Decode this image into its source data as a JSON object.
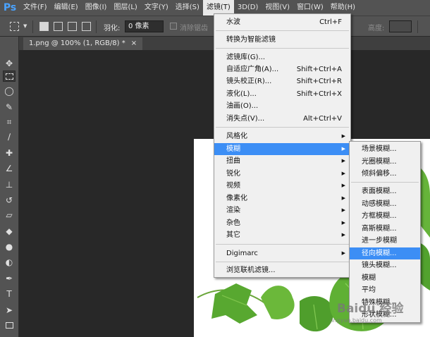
{
  "app": {
    "logo": "Ps"
  },
  "menubar": {
    "items": [
      "文件(F)",
      "编辑(E)",
      "图像(I)",
      "图层(L)",
      "文字(Y)",
      "选择(S)",
      "滤镜(T)",
      "3D(D)",
      "视图(V)",
      "窗口(W)",
      "帮助(H)"
    ],
    "active_index": 6
  },
  "options": {
    "feather_label": "羽化:",
    "feather_value": "0 像素",
    "antialias_label": "消除锯齿",
    "height_label": "高度:"
  },
  "document_tab": {
    "title": "1.png @ 100% (1, RGB/8) *",
    "close": "×"
  },
  "filter_menu": {
    "items": [
      {
        "label": "水波",
        "shortcut": "Ctrl+F"
      },
      {
        "label": "转换为智能滤镜"
      },
      {
        "label": "滤镜库(G)..."
      },
      {
        "label": "自适应广角(A)...",
        "shortcut": "Shift+Ctrl+A"
      },
      {
        "label": "镜头校正(R)...",
        "shortcut": "Shift+Ctrl+R"
      },
      {
        "label": "液化(L)...",
        "shortcut": "Shift+Ctrl+X"
      },
      {
        "label": "油画(O)..."
      },
      {
        "label": "消失点(V)...",
        "shortcut": "Alt+Ctrl+V"
      },
      {
        "label": "风格化"
      },
      {
        "label": "模糊"
      },
      {
        "label": "扭曲"
      },
      {
        "label": "锐化"
      },
      {
        "label": "视频"
      },
      {
        "label": "像素化"
      },
      {
        "label": "渲染"
      },
      {
        "label": "杂色"
      },
      {
        "label": "其它"
      },
      {
        "label": "Digimarc"
      },
      {
        "label": "浏览联机滤镜..."
      }
    ],
    "highlighted": "模糊"
  },
  "blur_submenu": {
    "items": [
      "场景模糊...",
      "光圈模糊...",
      "倾斜偏移...",
      "表面模糊...",
      "动感模糊...",
      "方框模糊...",
      "高斯模糊...",
      "进一步模糊",
      "径向模糊...",
      "镜头模糊...",
      "模糊",
      "平均",
      "特殊模糊...",
      "形状模糊..."
    ],
    "highlighted": "径向模糊..."
  },
  "watermark": {
    "text": "Baidu 经验",
    "url": "jingyan.baidu.com"
  }
}
